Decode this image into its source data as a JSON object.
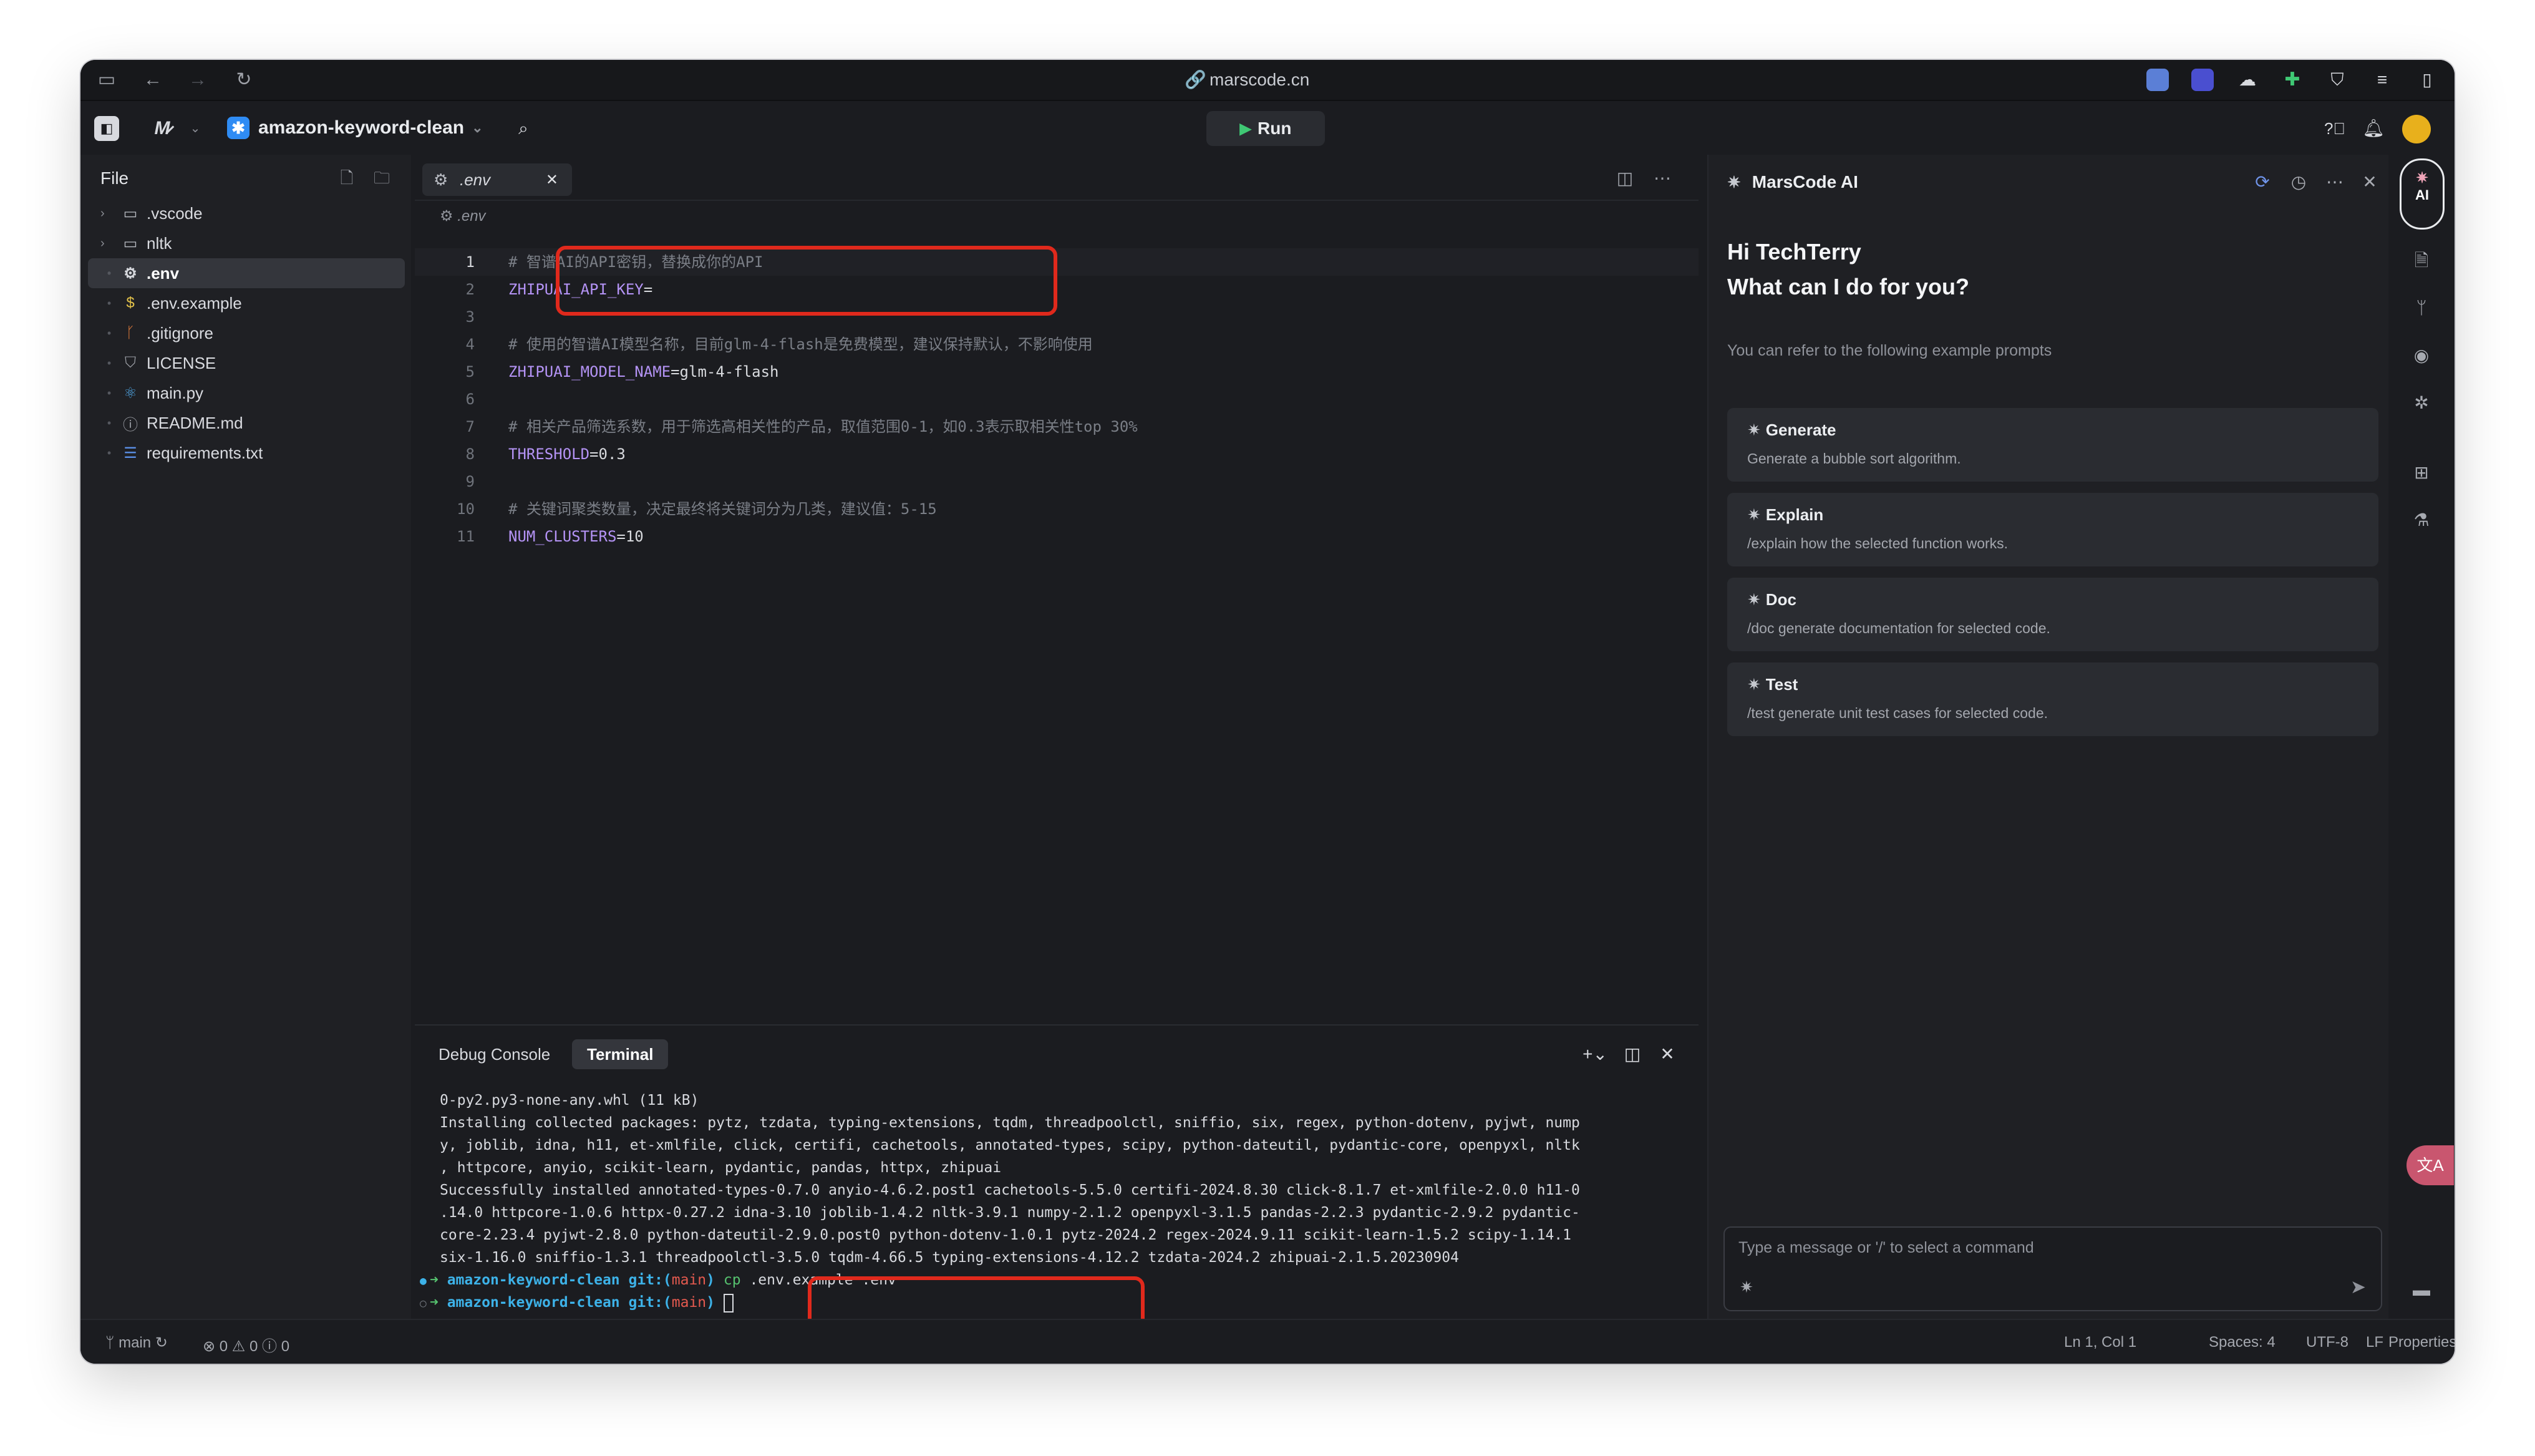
{
  "browser": {
    "url": "marscode.cn"
  },
  "header": {
    "project_name": "amazon-keyword-clean",
    "run_label": "Run"
  },
  "explorer": {
    "title": "File",
    "items": [
      {
        "label": ".vscode",
        "type": "folder",
        "icon": "folder-icon"
      },
      {
        "label": "nltk",
        "type": "folder",
        "icon": "folder-icon"
      },
      {
        "label": ".env",
        "type": "file",
        "icon": "gear-icon",
        "active": true
      },
      {
        "label": ".env.example",
        "type": "file",
        "icon": "dollar-icon"
      },
      {
        "label": ".gitignore",
        "type": "file",
        "icon": "git-icon"
      },
      {
        "label": "LICENSE",
        "type": "file",
        "icon": "license-icon"
      },
      {
        "label": "main.py",
        "type": "file",
        "icon": "python-icon"
      },
      {
        "label": "README.md",
        "type": "file",
        "icon": "info-icon"
      },
      {
        "label": "requirements.txt",
        "type": "file",
        "icon": "lines-icon"
      }
    ]
  },
  "editor": {
    "tab_label": ".env",
    "breadcrumb": ".env",
    "lines": [
      {
        "n": "1",
        "comment": "# 智谱AI的API密钥，替换成你的API",
        "key": "",
        "val": ""
      },
      {
        "n": "2",
        "comment": "",
        "key": "ZHIPUAI_API_KEY",
        "val": "="
      },
      {
        "n": "3",
        "comment": "",
        "key": "",
        "val": ""
      },
      {
        "n": "4",
        "comment": "# 使用的智谱AI模型名称，目前glm-4-flash是免费模型，建议保持默认，不影响使用",
        "key": "",
        "val": ""
      },
      {
        "n": "5",
        "comment": "",
        "key": "ZHIPUAI_MODEL_NAME",
        "val": "=glm-4-flash"
      },
      {
        "n": "6",
        "comment": "",
        "key": "",
        "val": ""
      },
      {
        "n": "7",
        "comment": "# 相关产品筛选系数，用于筛选高相关性的产品，取值范围0-1，如0.3表示取相关性top 30%",
        "key": "",
        "val": ""
      },
      {
        "n": "8",
        "comment": "",
        "key": "THRESHOLD",
        "val": "=0.3"
      },
      {
        "n": "9",
        "comment": "",
        "key": "",
        "val": ""
      },
      {
        "n": "10",
        "comment": "# 关键词聚类数量，决定最终将关键词分为几类，建议值：5-15",
        "key": "",
        "val": ""
      },
      {
        "n": "11",
        "comment": "",
        "key": "NUM_CLUSTERS",
        "val": "=10"
      }
    ]
  },
  "panel": {
    "tabs": [
      "Debug Console",
      "Terminal"
    ],
    "active_tab": "Terminal",
    "output": [
      "0-py2.py3-none-any.whl (11 kB)",
      "Installing collected packages: pytz, tzdata, typing-extensions, tqdm, threadpoolctl, sniffio, six, regex, python-dotenv, pyjwt, nump",
      "y, joblib, idna, h11, et-xmlfile, click, certifi, cachetools, annotated-types, scipy, python-dateutil, pydantic-core, openpyxl, nltk",
      ", httpcore, anyio, scikit-learn, pydantic, pandas, httpx, zhipuai",
      "Successfully installed annotated-types-0.7.0 anyio-4.6.2.post1 cachetools-5.5.0 certifi-2024.8.30 click-8.1.7 et-xmlfile-2.0.0 h11-0",
      ".14.0 httpcore-1.0.6 httpx-0.27.2 idna-3.10 joblib-1.4.2 nltk-3.9.1 numpy-2.1.2 openpyxl-3.1.5 pandas-2.2.3 pydantic-2.9.2 pydantic-",
      "core-2.23.4 pyjwt-2.8.0 python-dateutil-2.9.0.post0 python-dotenv-1.0.1 pytz-2024.2 regex-2024.9.11 scikit-learn-1.5.2 scipy-1.14.1",
      "six-1.16.0 sniffio-1.3.1 threadpoolctl-3.5.0 tqdm-4.66.5 typing-extensions-4.12.2 tzdata-2024.2 zhipuai-2.1.5.20230904"
    ],
    "prompt_dir": "amazon-keyword-clean",
    "prompt_git": "git:(",
    "prompt_branch": "main",
    "prompt_close": ")",
    "command_name": "cp",
    "command_args": ".env.example .env"
  },
  "ai": {
    "title": "MarsCode AI",
    "greeting": "Hi TechTerry",
    "question": "What can I do for you?",
    "refer_text": "You can refer to the following example prompts",
    "cards": [
      {
        "title": "Generate",
        "desc": "Generate a bubble sort algorithm."
      },
      {
        "title": "Explain",
        "desc": "/explain how the selected function works."
      },
      {
        "title": "Doc",
        "desc": "/doc generate documentation for selected code."
      },
      {
        "title": "Test",
        "desc": "/test generate unit test cases for selected code."
      }
    ],
    "input_placeholder": "Type a message or '/' to select a command"
  },
  "activity": {
    "ai_label": "AI"
  },
  "status": {
    "branch": "main",
    "errors": "0",
    "warnings": "0",
    "info": "0",
    "position": "Ln 1, Col 1",
    "spaces": "Spaces: 4",
    "encoding": "UTF-8",
    "eol": "LF",
    "properties": "Properties"
  },
  "colors": {
    "accent_run": "#3fc874",
    "highlight_box": "#e0291c",
    "env_key": "#b493f5",
    "prompt_dir": "#3db2e8"
  }
}
